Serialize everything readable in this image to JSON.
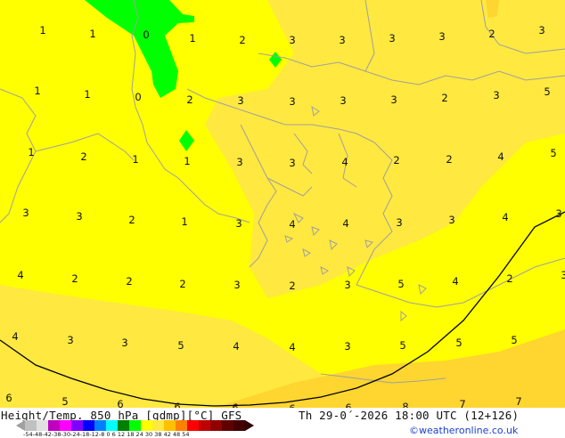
{
  "map": {
    "colors": {
      "band_0_4": "#ffff00",
      "band_4_8": "#ffe840",
      "band_8_12": "#ffd530",
      "band_neg": "#00ff00",
      "coast": "#a0a0a0",
      "freezing_line": "#000000"
    },
    "temperature_labels": [
      "1",
      "1",
      "0",
      "1",
      "2",
      "3",
      "3",
      "3",
      "3",
      "2",
      "3",
      "1",
      "1",
      "0",
      "2",
      "3",
      "3",
      "3",
      "3",
      "2",
      "3",
      "5",
      "1",
      "2",
      "1",
      "1",
      "3",
      "3",
      "4",
      "2",
      "2",
      "4",
      "5",
      "3",
      "3",
      "2",
      "1",
      "3",
      "4",
      "4",
      "3",
      "3",
      "4",
      "3",
      "4",
      "2",
      "2",
      "2",
      "3",
      "2",
      "3",
      "5",
      "4",
      "2",
      "3",
      "4",
      "3",
      "3",
      "5",
      "4",
      "4",
      "3",
      "5",
      "5",
      "5",
      "6",
      "5",
      "6",
      "6",
      "6",
      "6",
      "6",
      "8",
      "7",
      "7"
    ]
  },
  "footer": {
    "title": "Height/Temp. 850 hPa [gdmp][°C] GFS",
    "datetime": "Th 29-0´-2026 18:00 UTC (12+126)",
    "credit": "©weatheronline.co.uk",
    "colorbar_ticks": "-54-48-42-38-30-24-18-12-8  0  6  12 18 24 30 38 42 48 54"
  }
}
